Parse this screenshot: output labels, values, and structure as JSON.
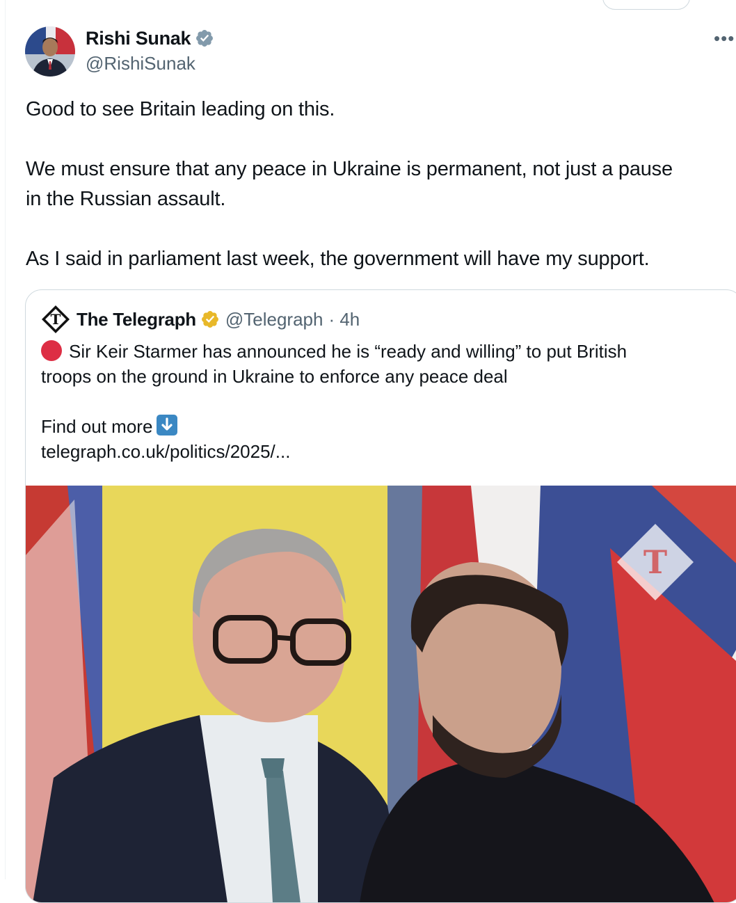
{
  "tweet": {
    "author_name": "Rishi Sunak",
    "author_handle": "@RishiSunak",
    "more_icon": "more-horizontal-icon",
    "lines": [
      "Good to see Britain leading on this.",
      "",
      "We must ensure that any peace in Ukraine is permanent, not just a pause",
      "in the Russian assault.",
      "",
      "As I said in parliament last week, the government will have my support."
    ]
  },
  "quote": {
    "author_name": "The Telegraph",
    "author_handle": "@Telegraph",
    "time": "· 4h",
    "lines": [
      "Sir Keir Starmer has announced he is “ready and willing” to put British",
      "troops on the ground in Ukraine to enforce any peace deal",
      "",
      "Find out more",
      "telegraph.co.uk/politics/2025/..."
    ],
    "image_watermark": "T"
  },
  "colors": {
    "text": "#0f1419",
    "secondary": "#536471",
    "verified_blue": "#1d9bf0",
    "verified_gold": "#e8b829",
    "border": "#cfd9de"
  }
}
